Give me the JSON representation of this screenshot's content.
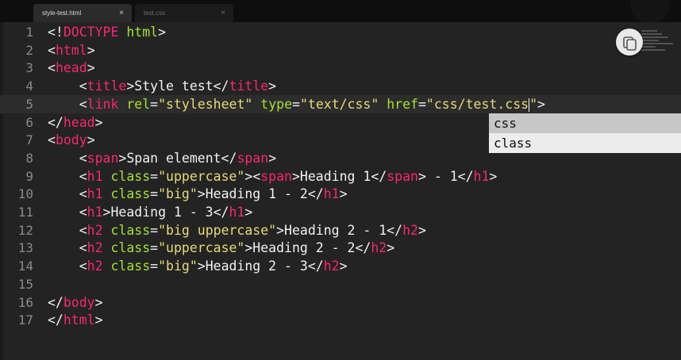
{
  "tabs": [
    {
      "label": "style-test.html",
      "close": "×"
    },
    {
      "label": "test.css",
      "close": "×"
    }
  ],
  "lines": [
    {
      "n": "1",
      "tokens": [
        [
          "p",
          "<!"
        ],
        [
          "t",
          "DOCTYPE"
        ],
        [
          "p",
          " "
        ],
        [
          "a",
          "html"
        ],
        [
          "p",
          ">"
        ]
      ]
    },
    {
      "n": "2",
      "tokens": [
        [
          "p",
          "<"
        ],
        [
          "t",
          "html"
        ],
        [
          "p",
          ">"
        ]
      ]
    },
    {
      "n": "3",
      "tokens": [
        [
          "p",
          "<"
        ],
        [
          "t",
          "head"
        ],
        [
          "p",
          ">"
        ]
      ]
    },
    {
      "n": "4",
      "tokens": [
        [
          "p",
          "    <"
        ],
        [
          "t",
          "title"
        ],
        [
          "p",
          ">Style test</"
        ],
        [
          "t",
          "title"
        ],
        [
          "p",
          ">"
        ]
      ]
    },
    {
      "n": "5",
      "tokens": [
        [
          "p",
          "    <"
        ],
        [
          "t",
          "link"
        ],
        [
          "p",
          " "
        ],
        [
          "a",
          "rel"
        ],
        [
          "p",
          "="
        ],
        [
          "s",
          "\"stylesheet\""
        ],
        [
          "p",
          " "
        ],
        [
          "a",
          "type"
        ],
        [
          "p",
          "="
        ],
        [
          "s",
          "\"text/css\""
        ],
        [
          "p",
          " "
        ],
        [
          "a",
          "href"
        ],
        [
          "p",
          "="
        ],
        [
          "s",
          "\"css/test.css"
        ],
        [
          "cursor",
          ""
        ],
        [
          "s",
          "\""
        ],
        [
          "p",
          ">"
        ]
      ],
      "highlight": true
    },
    {
      "n": "6",
      "tokens": [
        [
          "p",
          "</"
        ],
        [
          "t",
          "head"
        ],
        [
          "p",
          ">"
        ]
      ]
    },
    {
      "n": "7",
      "tokens": [
        [
          "p",
          "<"
        ],
        [
          "t",
          "body"
        ],
        [
          "p",
          ">"
        ]
      ]
    },
    {
      "n": "8",
      "tokens": [
        [
          "p",
          "    <"
        ],
        [
          "t",
          "span"
        ],
        [
          "p",
          ">Span element</"
        ],
        [
          "t",
          "span"
        ],
        [
          "p",
          ">"
        ]
      ]
    },
    {
      "n": "9",
      "tokens": [
        [
          "p",
          "    <"
        ],
        [
          "t",
          "h1"
        ],
        [
          "p",
          " "
        ],
        [
          "a",
          "class"
        ],
        [
          "p",
          "="
        ],
        [
          "s",
          "\"uppercase\""
        ],
        [
          "p",
          ">"
        ],
        [
          "p",
          "<"
        ],
        [
          "t",
          "span"
        ],
        [
          "p",
          ">Heading 1</"
        ],
        [
          "t",
          "span"
        ],
        [
          "p",
          "> - 1</"
        ],
        [
          "t",
          "h1"
        ],
        [
          "p",
          ">"
        ]
      ]
    },
    {
      "n": "10",
      "tokens": [
        [
          "p",
          "    <"
        ],
        [
          "t",
          "h1"
        ],
        [
          "p",
          " "
        ],
        [
          "a",
          "class"
        ],
        [
          "p",
          "="
        ],
        [
          "s",
          "\"big\""
        ],
        [
          "p",
          ">Heading 1 - 2</"
        ],
        [
          "t",
          "h1"
        ],
        [
          "p",
          ">"
        ]
      ]
    },
    {
      "n": "11",
      "tokens": [
        [
          "p",
          "    <"
        ],
        [
          "t",
          "h1"
        ],
        [
          "p",
          ">Heading 1 - 3</"
        ],
        [
          "t",
          "h1"
        ],
        [
          "p",
          ">"
        ]
      ]
    },
    {
      "n": "12",
      "tokens": [
        [
          "p",
          "    <"
        ],
        [
          "t",
          "h2"
        ],
        [
          "p",
          " "
        ],
        [
          "a",
          "class"
        ],
        [
          "p",
          "="
        ],
        [
          "s",
          "\"big uppercase\""
        ],
        [
          "p",
          ">Heading 2 - 1</"
        ],
        [
          "t",
          "h2"
        ],
        [
          "p",
          ">"
        ]
      ]
    },
    {
      "n": "13",
      "tokens": [
        [
          "p",
          "    <"
        ],
        [
          "t",
          "h2"
        ],
        [
          "p",
          " "
        ],
        [
          "a",
          "class"
        ],
        [
          "p",
          "="
        ],
        [
          "s",
          "\"uppercase\""
        ],
        [
          "p",
          ">Heading 2 - 2</"
        ],
        [
          "t",
          "h2"
        ],
        [
          "p",
          ">"
        ]
      ]
    },
    {
      "n": "14",
      "tokens": [
        [
          "p",
          "    <"
        ],
        [
          "t",
          "h2"
        ],
        [
          "p",
          " "
        ],
        [
          "a",
          "class"
        ],
        [
          "p",
          "="
        ],
        [
          "s",
          "\"big\""
        ],
        [
          "p",
          ">Heading 2 - 3</"
        ],
        [
          "t",
          "h2"
        ],
        [
          "p",
          ">"
        ]
      ]
    },
    {
      "n": "15",
      "tokens": []
    },
    {
      "n": "16",
      "tokens": [
        [
          "p",
          "</"
        ],
        [
          "t",
          "body"
        ],
        [
          "p",
          ">"
        ]
      ]
    },
    {
      "n": "17",
      "tokens": [
        [
          "p",
          "</"
        ],
        [
          "t",
          "html"
        ],
        [
          "p",
          ">"
        ]
      ]
    }
  ],
  "autocomplete": {
    "items": [
      "css",
      "class"
    ],
    "selected": "css"
  },
  "colors": {
    "tag": "#f92672",
    "attribute": "#a6e22e",
    "string": "#e6db74",
    "text": "#f1f1f1",
    "background": "#232323"
  }
}
